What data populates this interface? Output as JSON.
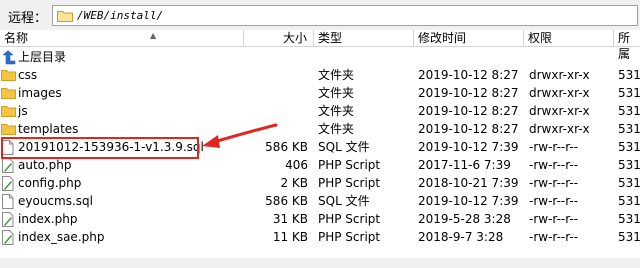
{
  "pathbar": {
    "label": "远程：",
    "path": "/WEB/install/"
  },
  "columns": {
    "name": "名称",
    "size": "大小",
    "type": "类型",
    "modified": "修改时间",
    "permissions": "权限",
    "owner": "所属"
  },
  "files": [
    {
      "name": "上层目录",
      "size": "",
      "type": "",
      "modified": "",
      "permissions": "",
      "owner": "",
      "icon": "parent-dir-icon"
    },
    {
      "name": "css",
      "size": "",
      "type": "文件夹",
      "modified": "2019-10-12 8:27",
      "permissions": "drwxr-xr-x",
      "owner": "531",
      "icon": "folder-icon"
    },
    {
      "name": "images",
      "size": "",
      "type": "文件夹",
      "modified": "2019-10-12 8:27",
      "permissions": "drwxr-xr-x",
      "owner": "531",
      "icon": "folder-icon"
    },
    {
      "name": "js",
      "size": "",
      "type": "文件夹",
      "modified": "2019-10-12 8:27",
      "permissions": "drwxr-xr-x",
      "owner": "531",
      "icon": "folder-icon"
    },
    {
      "name": "templates",
      "size": "",
      "type": "文件夹",
      "modified": "2019-10-12 8:27",
      "permissions": "drwxr-xr-x",
      "owner": "531",
      "icon": "folder-icon"
    },
    {
      "name": "20191012-153936-1-v1.3.9.sql",
      "size": "586 KB",
      "type": "SQL 文件",
      "modified": "2019-10-12 7:39",
      "permissions": "-rw-r--r--",
      "owner": "531",
      "icon": "file-icon"
    },
    {
      "name": "auto.php",
      "size": "406",
      "type": "PHP Script",
      "modified": "2017-11-6 7:39",
      "permissions": "-rw-r--r--",
      "owner": "531",
      "icon": "php-file-icon"
    },
    {
      "name": "config.php",
      "size": "2 KB",
      "type": "PHP Script",
      "modified": "2018-10-21 7:39",
      "permissions": "-rw-r--r--",
      "owner": "531",
      "icon": "php-file-icon"
    },
    {
      "name": "eyoucms.sql",
      "size": "586 KB",
      "type": "SQL 文件",
      "modified": "2019-10-12 7:39",
      "permissions": "-rw-r--r--",
      "owner": "531",
      "icon": "file-icon"
    },
    {
      "name": "index.php",
      "size": "31 KB",
      "type": "PHP Script",
      "modified": "2019-5-28 3:28",
      "permissions": "-rw-r--r--",
      "owner": "531",
      "icon": "php-file-icon"
    },
    {
      "name": "index_sae.php",
      "size": "11 KB",
      "type": "PHP Script",
      "modified": "2018-9-7 3:28",
      "permissions": "-rw-r--r--",
      "owner": "531",
      "icon": "php-file-icon"
    }
  ],
  "colors": {
    "highlight": "#e0261e",
    "folder": "#f5c542",
    "php": "#3f8f3a"
  }
}
